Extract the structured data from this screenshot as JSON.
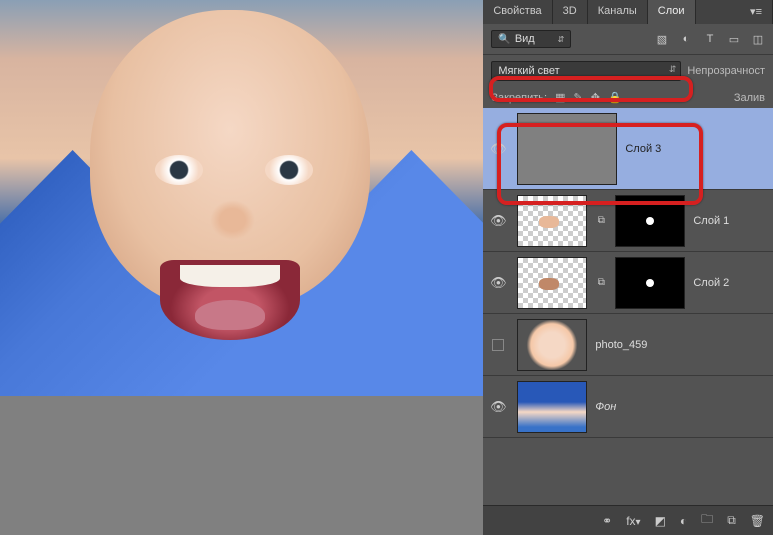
{
  "tabs": {
    "props": "Свойства",
    "3d": "3D",
    "channels": "Каналы",
    "layers": "Слои"
  },
  "filter": {
    "kind": "Вид"
  },
  "blend": {
    "mode": "Мягкий свет",
    "opacity_label": "Непрозрачност"
  },
  "lock": {
    "label": "Закрепить:",
    "fill_label": "Залив"
  },
  "layers": {
    "3": {
      "name": "Слой 3"
    },
    "1": {
      "name": "Слой 1"
    },
    "2": {
      "name": "Слой 2"
    },
    "p": {
      "name": "photo_459"
    },
    "bg": {
      "name": "Фон"
    }
  },
  "icons": {
    "image": "img",
    "adjust": "adj",
    "type": "T",
    "shape": "shape",
    "smart": "smart",
    "link": "link",
    "fx": "fx",
    "mask": "mask",
    "fill": "fill",
    "group": "grp",
    "new": "new",
    "trash": "trash"
  }
}
